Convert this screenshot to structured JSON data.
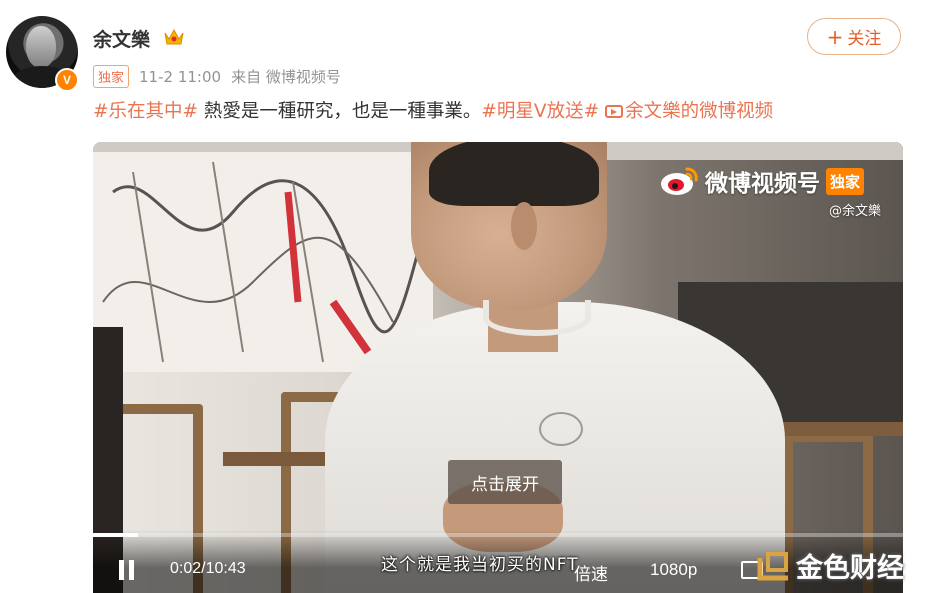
{
  "user": {
    "name": "余文樂",
    "verified_badge": "V"
  },
  "follow_button": {
    "label": "关注"
  },
  "meta": {
    "tag": "独家",
    "time": "11-2 11:00",
    "source": "来自 微博视频号"
  },
  "post": {
    "hashtag1": "#乐在其中#",
    "text": " 熱愛是一種研究，也是一種事業。",
    "hashtag2": "#明星V放送#",
    "video_link": "余文樂的微博视频"
  },
  "video": {
    "channel_name": "微博视频号",
    "channel_tag": "独家",
    "handle": "@余文樂",
    "expand_label": "点击展开",
    "subtitle": "这个就是我当初买的NFT",
    "time": "0:02/10:43",
    "speed_label": "倍速",
    "quality_label": "1080p",
    "progress": 0.003
  },
  "watermark": {
    "text": "金色财经"
  },
  "colors": {
    "accent": "#eb7350",
    "brand": "#ff8200"
  }
}
